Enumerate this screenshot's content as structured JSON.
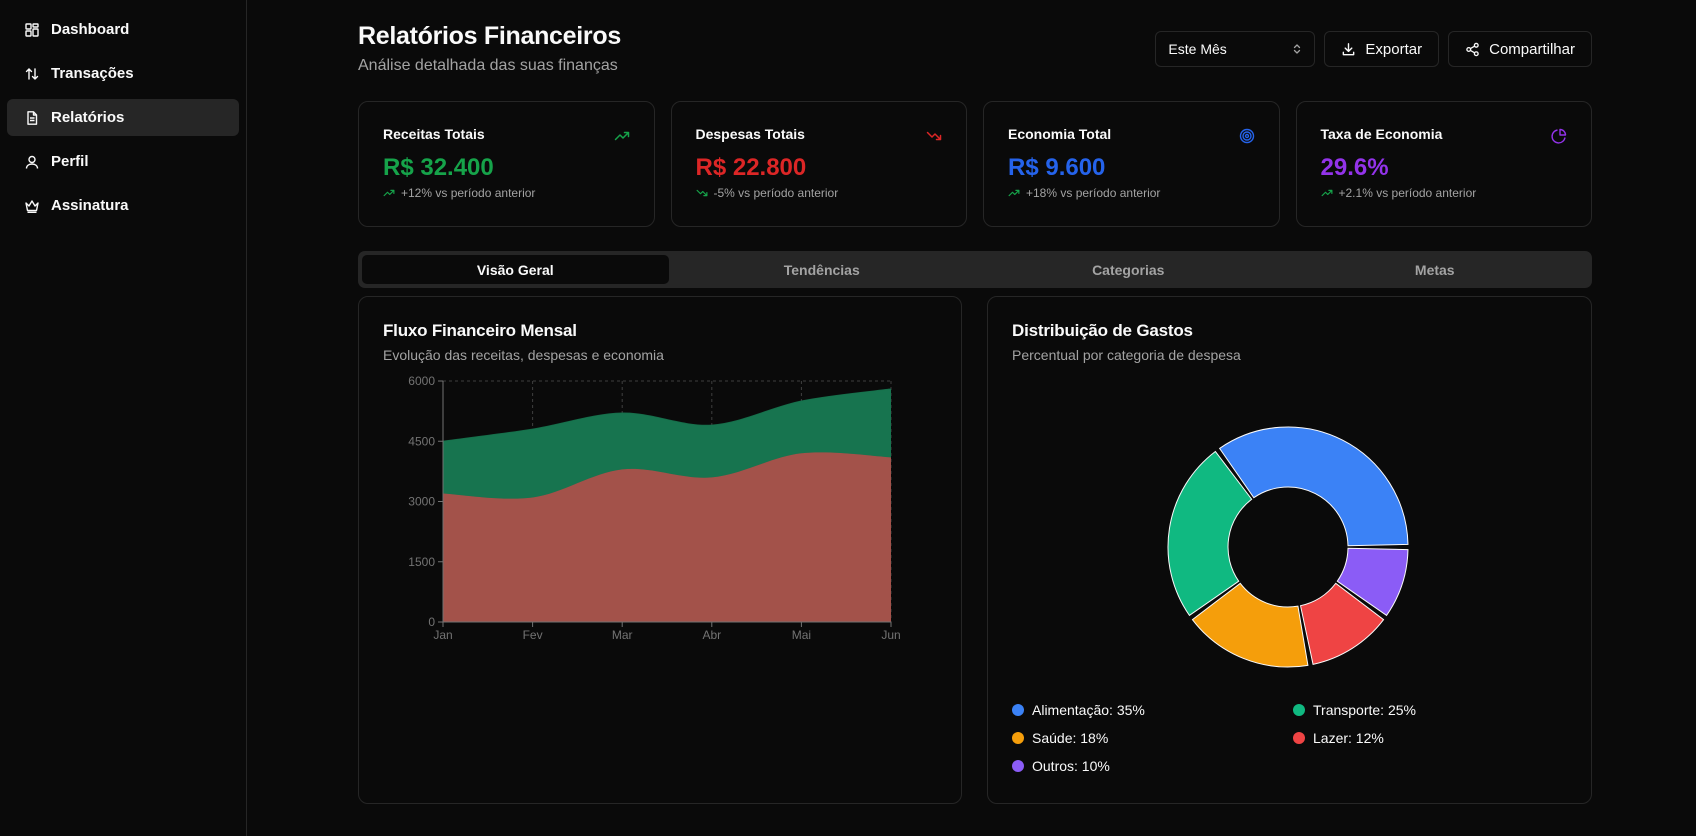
{
  "sidebar": {
    "items": [
      {
        "label": "Dashboard",
        "icon": "dashboard-icon",
        "active": false
      },
      {
        "label": "Transações",
        "icon": "arrows-up-down-icon",
        "active": false
      },
      {
        "label": "Relatórios",
        "icon": "document-icon",
        "active": true
      },
      {
        "label": "Perfil",
        "icon": "user-icon",
        "active": false
      },
      {
        "label": "Assinatura",
        "icon": "crown-icon",
        "active": false
      }
    ]
  },
  "header": {
    "title": "Relatórios Financeiros",
    "subtitle": "Análise detalhada das suas finanças",
    "period_select": "Este Mês",
    "export_label": "Exportar",
    "share_label": "Compartilhar"
  },
  "cards": [
    {
      "title": "Receitas Totais",
      "value": "R$ 32.400",
      "change": "+12% vs período anterior",
      "color": "#16a34a",
      "icon": "trending-up-icon"
    },
    {
      "title": "Despesas Totais",
      "value": "R$ 22.800",
      "change": "-5% vs período anterior",
      "color": "#dc2626",
      "icon": "trending-down-icon"
    },
    {
      "title": "Economia Total",
      "value": "R$ 9.600",
      "change": "+18% vs período anterior",
      "color": "#2563eb",
      "icon": "target-icon"
    },
    {
      "title": "Taxa de Economia",
      "value": "29.6%",
      "change": "+2.1% vs período anterior",
      "color": "#9333ea",
      "icon": "pie-chart-icon"
    }
  ],
  "tabs": [
    {
      "label": "Visão Geral",
      "active": true
    },
    {
      "label": "Tendências",
      "active": false
    },
    {
      "label": "Categorias",
      "active": false
    },
    {
      "label": "Metas",
      "active": false
    }
  ],
  "flow_panel": {
    "title": "Fluxo Financeiro Mensal",
    "subtitle": "Evolução das receitas, despesas e economia"
  },
  "dist_panel": {
    "title": "Distribuição de Gastos",
    "subtitle": "Percentual por categoria de despesa"
  },
  "chart_data": [
    {
      "type": "area",
      "x": [
        "Jan",
        "Fev",
        "Mar",
        "Abr",
        "Mai",
        "Jun"
      ],
      "ylim": [
        0,
        6000
      ],
      "yticks": [
        0,
        1500,
        3000,
        4500,
        6000
      ],
      "grid": true,
      "stacked": true,
      "series": [
        {
          "values": [
            3200,
            3100,
            3800,
            3600,
            4200,
            4100
          ],
          "color": "#a3524a"
        },
        {
          "values": [
            1300,
            1700,
            1400,
            1300,
            1300,
            1700
          ],
          "color": "#17744f"
        }
      ]
    },
    {
      "type": "pie",
      "donut": true,
      "slices": [
        {
          "label": "Alimentação",
          "value": 35,
          "color": "#3b82f6"
        },
        {
          "label": "Transporte",
          "value": 25,
          "color": "#10b981"
        },
        {
          "label": "Saúde",
          "value": 18,
          "color": "#f59e0b"
        },
        {
          "label": "Lazer",
          "value": 12,
          "color": "#ef4444"
        },
        {
          "label": "Outros",
          "value": 10,
          "color": "#8b5cf6"
        }
      ],
      "legend": [
        {
          "text": "Alimentação: 35%",
          "color": "#3b82f6"
        },
        {
          "text": "Transporte: 25%",
          "color": "#10b981"
        },
        {
          "text": "Saúde: 18%",
          "color": "#f59e0b"
        },
        {
          "text": "Lazer: 12%",
          "color": "#ef4444"
        },
        {
          "text": "Outros: 10%",
          "color": "#8b5cf6"
        }
      ]
    }
  ]
}
